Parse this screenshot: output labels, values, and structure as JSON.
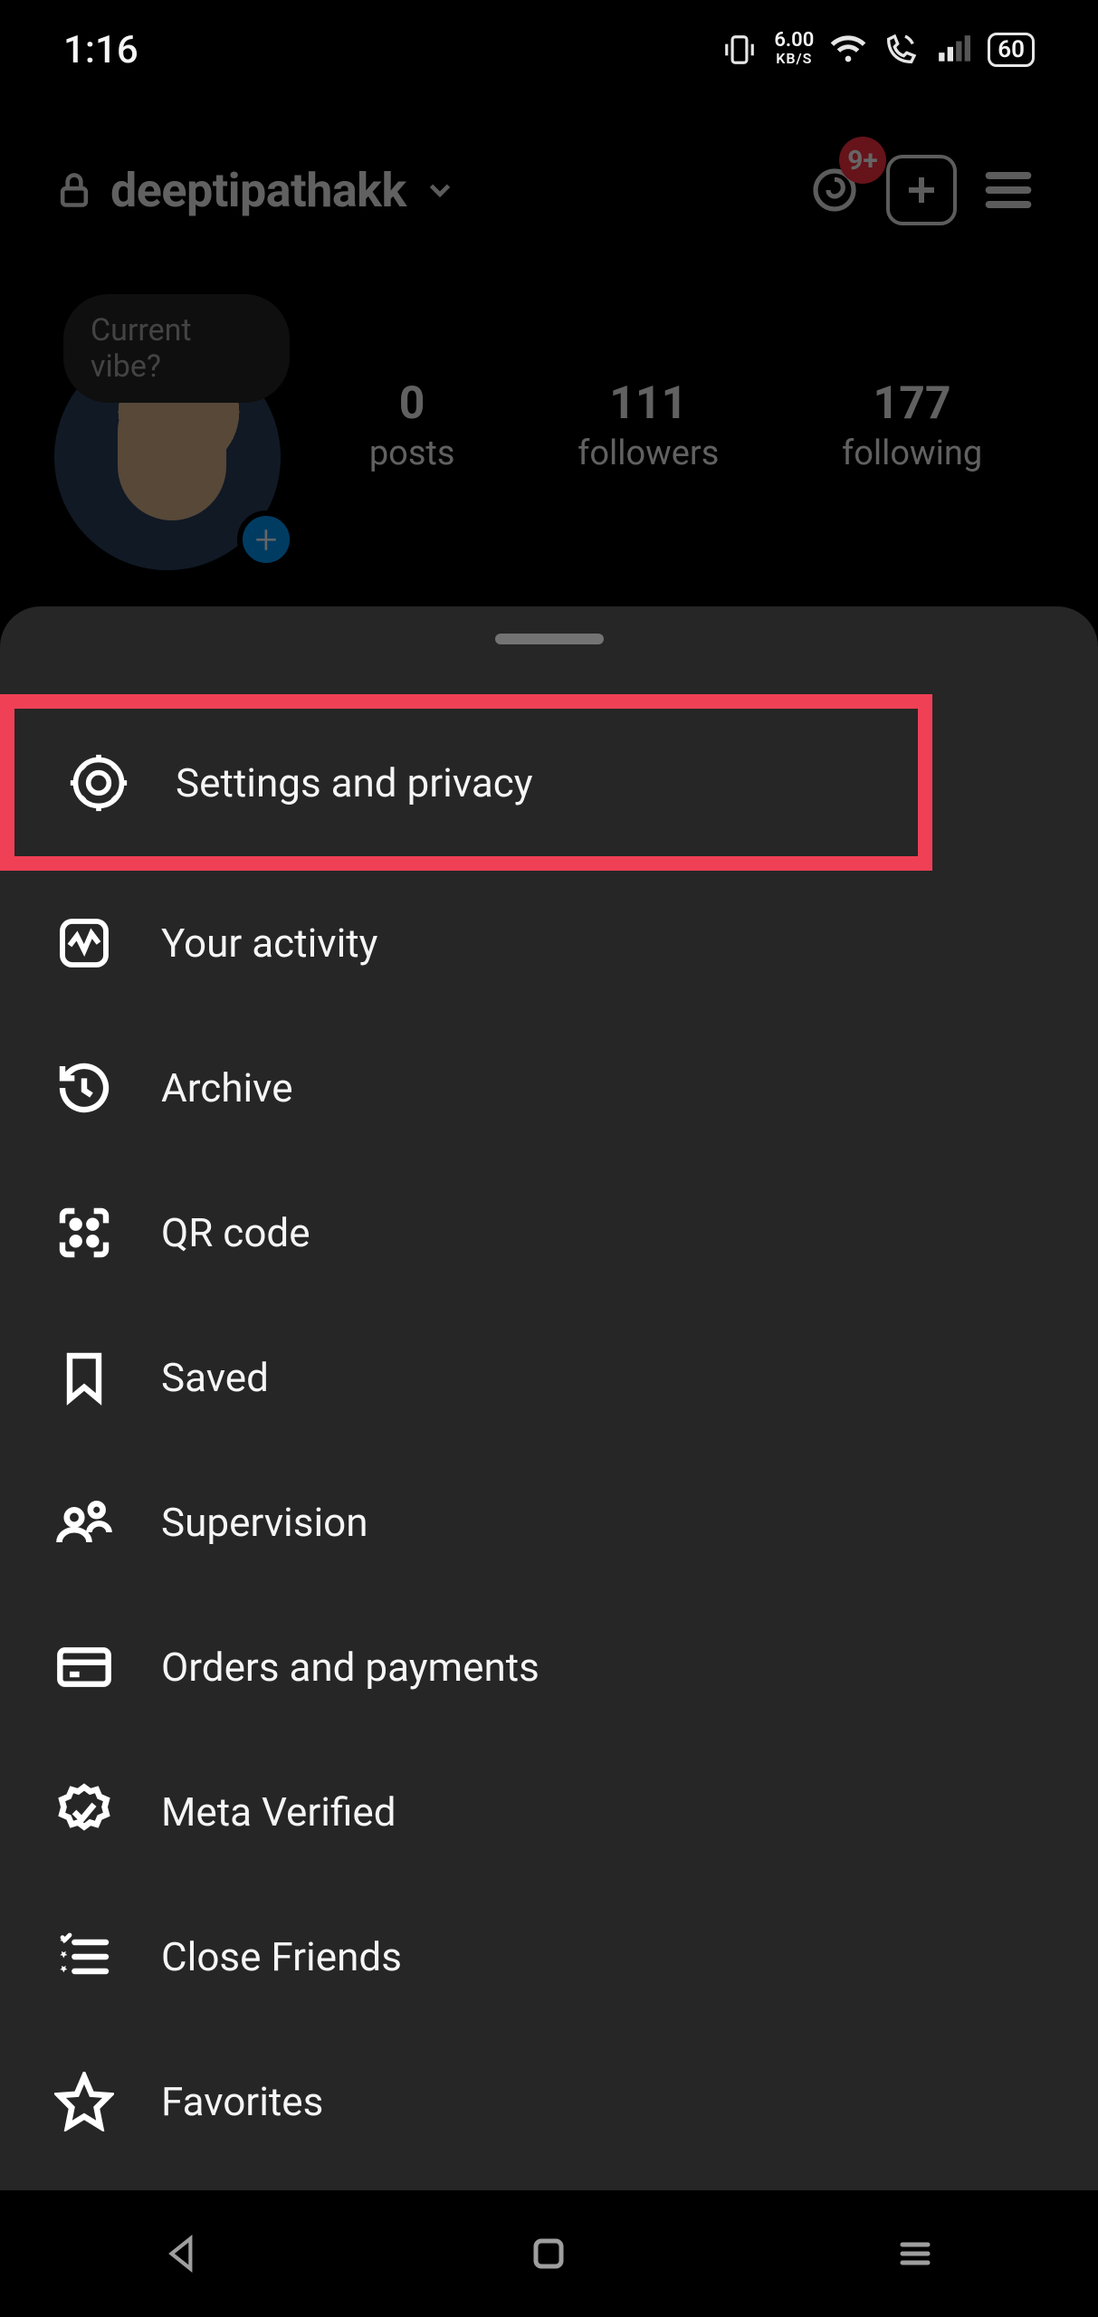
{
  "status": {
    "time": "1:16",
    "net_value": "6.00",
    "net_label": "KB/S",
    "battery": "60"
  },
  "profile": {
    "username": "deeptipathakk",
    "threads_badge": "9+",
    "note_prompt": "Current vibe?",
    "stats": [
      {
        "count": "0",
        "label": "posts"
      },
      {
        "count": "111",
        "label": "followers"
      },
      {
        "count": "177",
        "label": "following"
      }
    ]
  },
  "menu": {
    "items": [
      {
        "label": "Settings and privacy",
        "icon": "gear-icon",
        "highlighted": true
      },
      {
        "label": "Your activity",
        "icon": "activity-icon",
        "highlighted": false
      },
      {
        "label": "Archive",
        "icon": "archive-icon",
        "highlighted": false
      },
      {
        "label": "QR code",
        "icon": "qr-icon",
        "highlighted": false
      },
      {
        "label": "Saved",
        "icon": "bookmark-icon",
        "highlighted": false
      },
      {
        "label": "Supervision",
        "icon": "supervision-icon",
        "highlighted": false
      },
      {
        "label": "Orders and payments",
        "icon": "card-icon",
        "highlighted": false
      },
      {
        "label": "Meta Verified",
        "icon": "verified-icon",
        "highlighted": false
      },
      {
        "label": "Close Friends",
        "icon": "close-friends-icon",
        "highlighted": false
      },
      {
        "label": "Favorites",
        "icon": "star-icon",
        "highlighted": false
      }
    ]
  }
}
